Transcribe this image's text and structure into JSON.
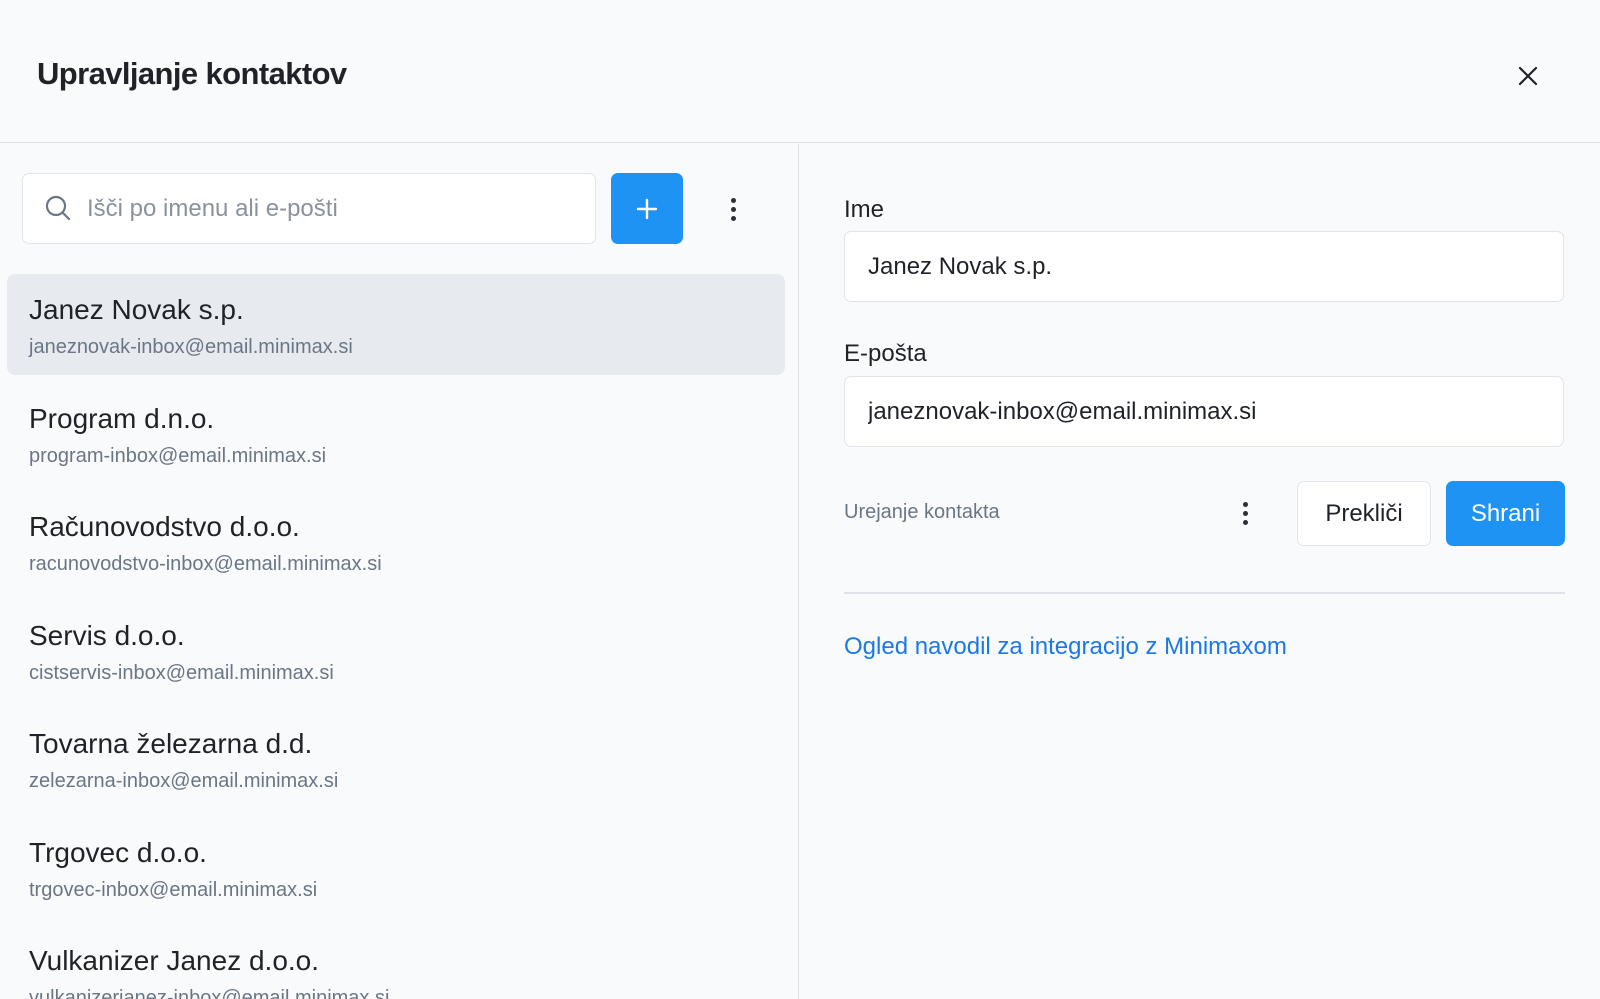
{
  "header": {
    "title": "Upravljanje kontaktov"
  },
  "search": {
    "placeholder": "Išči po imenu ali e-pošti",
    "value": ""
  },
  "contacts": [
    {
      "name": "Janez Novak s.p.",
      "email": "janeznovak-inbox@email.minimax.si",
      "selected": true
    },
    {
      "name": "Program d.n.o.",
      "email": "program-inbox@email.minimax.si"
    },
    {
      "name": "Računovodstvo d.o.o.",
      "email": "racunovodstvo-inbox@email.minimax.si"
    },
    {
      "name": "Servis d.o.o.",
      "email": "cistservis-inbox@email.minimax.si"
    },
    {
      "name": "Tovarna železarna d.d.",
      "email": "zelezarna-inbox@email.minimax.si"
    },
    {
      "name": "Trgovec d.o.o.",
      "email": "trgovec-inbox@email.minimax.si"
    },
    {
      "name": "Vulkanizer Janez d.o.o.",
      "email": "vulkanizerjanez-inbox@email.minimax.si"
    }
  ],
  "form": {
    "name_label": "Ime",
    "name_value": "Janez Novak s.p.",
    "email_label": "E-pošta",
    "email_value": "janeznovak-inbox@email.minimax.si",
    "edit_hint": "Urejanje kontakta",
    "cancel_label": "Prekliči",
    "save_label": "Shrani",
    "guide_link": "Ogled navodil za integracijo z Minimaxom"
  },
  "icons": {
    "close": "close-icon",
    "search": "search-icon",
    "add": "plus-icon",
    "more": "more-vertical-icon"
  },
  "colors": {
    "accent": "#1f93f3",
    "link": "#1b78e8",
    "selected_row": "#e7ebf0",
    "background": "#f9fafb"
  }
}
